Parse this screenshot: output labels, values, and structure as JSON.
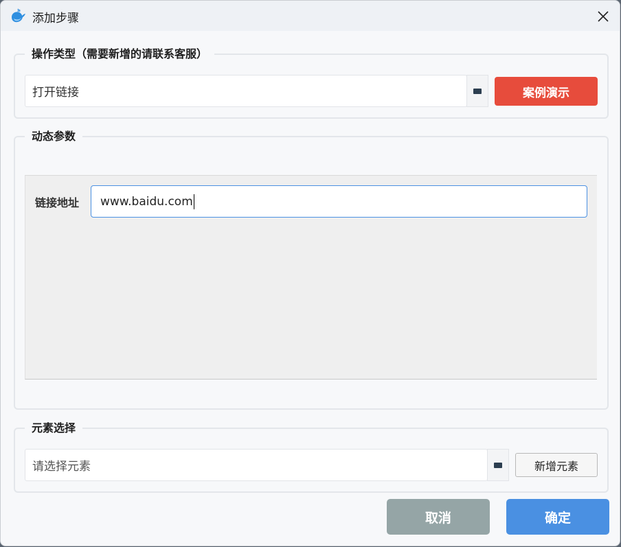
{
  "dialog": {
    "title": "添加步骤"
  },
  "operation_group": {
    "legend": "操作类型（需要新增的请联系客服）",
    "selected_value": "打开链接",
    "demo_button": "案例演示"
  },
  "params_group": {
    "legend": "动态参数",
    "link_label": "链接地址",
    "link_value": "www.baidu.com"
  },
  "element_group": {
    "legend": "元素选择",
    "placeholder": "请选择元素",
    "add_button": "新增元素"
  },
  "footer": {
    "cancel_label": "取消",
    "ok_label": "确定"
  },
  "colors": {
    "accent": "#4a90e2",
    "danger": "#e74c3c",
    "muted": "#95a5a6"
  }
}
